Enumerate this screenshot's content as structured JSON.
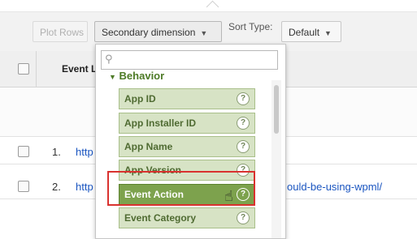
{
  "toolbar": {
    "plot_rows_label": "Plot Rows",
    "secondary_dimension_label": "Secondary dimension",
    "sort_type_label": "Sort Type:",
    "sort_type_value": "Default"
  },
  "table": {
    "column_event_label": "Event L",
    "rows": [
      {
        "num": "1.",
        "link_text": "http"
      },
      {
        "num": "2.",
        "link_text": "http",
        "link_tail": "ould-be-using-wpml/"
      }
    ]
  },
  "dropdown": {
    "search_placeholder": "",
    "group_title": "Behavior",
    "items": [
      {
        "label": "App ID"
      },
      {
        "label": "App Installer ID"
      },
      {
        "label": "App Name"
      },
      {
        "label": "App Version"
      },
      {
        "label": "Event Action",
        "selected": true
      },
      {
        "label": "Event Category"
      }
    ]
  },
  "colors": {
    "item_bg": "#d7e3c5",
    "item_selected_bg": "#7da24d",
    "group_title": "#4d7a26",
    "link": "#1a55c0",
    "highlight_border": "#d9322f"
  }
}
